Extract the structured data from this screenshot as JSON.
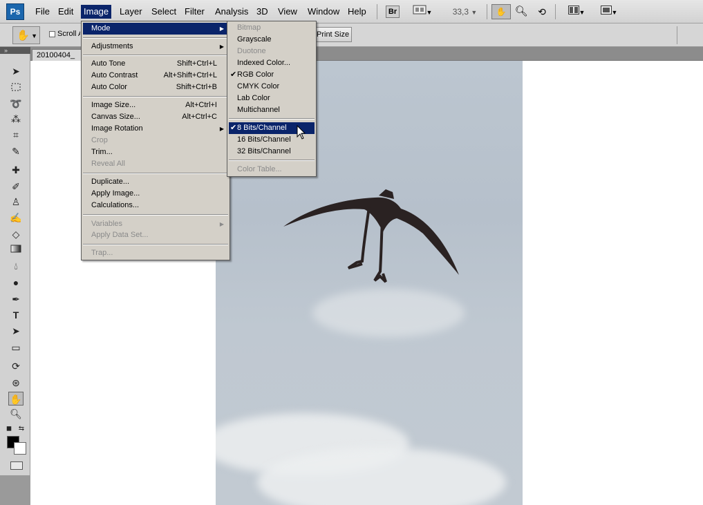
{
  "app": {
    "logo": "Ps"
  },
  "menubar": {
    "items": [
      "File",
      "Edit",
      "Image",
      "Layer",
      "Select",
      "Filter",
      "Analysis",
      "3D",
      "View",
      "Window",
      "Help"
    ],
    "bridge_label": "Br",
    "zoom_value": "33,3"
  },
  "options": {
    "scroll_all_label": "Scroll All Windows",
    "print_size_label": "Print Size"
  },
  "document": {
    "tab_title": "20100404_"
  },
  "image_menu": {
    "items": [
      {
        "label": "Mode",
        "shortcut": "",
        "submenu": true,
        "highlighted": true
      },
      {
        "label": "Adjustments",
        "shortcut": "",
        "submenu": true
      },
      {
        "label": "Auto Tone",
        "shortcut": "Shift+Ctrl+L"
      },
      {
        "label": "Auto Contrast",
        "shortcut": "Alt+Shift+Ctrl+L"
      },
      {
        "label": "Auto Color",
        "shortcut": "Shift+Ctrl+B"
      },
      {
        "label": "Image Size...",
        "shortcut": "Alt+Ctrl+I"
      },
      {
        "label": "Canvas Size...",
        "shortcut": "Alt+Ctrl+C"
      },
      {
        "label": "Image Rotation",
        "shortcut": "",
        "submenu": true
      },
      {
        "label": "Crop",
        "shortcut": "",
        "disabled": true
      },
      {
        "label": "Trim...",
        "shortcut": ""
      },
      {
        "label": "Reveal All",
        "shortcut": "",
        "disabled": true
      },
      {
        "label": "Duplicate...",
        "shortcut": ""
      },
      {
        "label": "Apply Image...",
        "shortcut": ""
      },
      {
        "label": "Calculations...",
        "shortcut": ""
      },
      {
        "label": "Variables",
        "shortcut": "",
        "submenu": true,
        "disabled": true
      },
      {
        "label": "Apply Data Set...",
        "shortcut": "",
        "disabled": true
      },
      {
        "label": "Trap...",
        "shortcut": "",
        "disabled": true
      }
    ]
  },
  "mode_menu": {
    "items": [
      {
        "label": "Bitmap",
        "disabled": true
      },
      {
        "label": "Grayscale"
      },
      {
        "label": "Duotone",
        "disabled": true
      },
      {
        "label": "Indexed Color..."
      },
      {
        "label": "RGB Color",
        "checked": true
      },
      {
        "label": "CMYK Color"
      },
      {
        "label": "Lab Color"
      },
      {
        "label": "Multichannel"
      },
      {
        "label": "8 Bits/Channel",
        "checked": true,
        "highlighted": true
      },
      {
        "label": "16 Bits/Channel"
      },
      {
        "label": "32 Bits/Channel"
      },
      {
        "label": "Color Table...",
        "disabled": true
      }
    ]
  }
}
